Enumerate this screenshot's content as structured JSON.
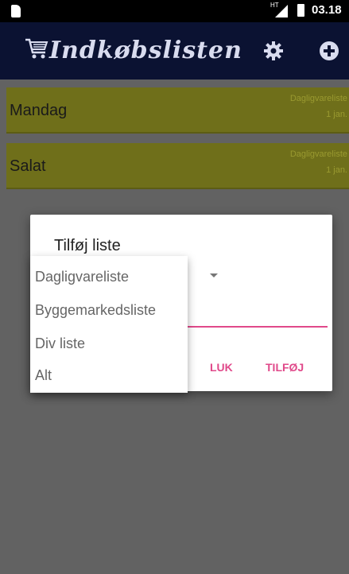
{
  "status_bar": {
    "time": "03.18",
    "network": "HT"
  },
  "app_bar": {
    "title": "Indkøbslisten",
    "icons": {
      "cart": "shopping-cart-icon",
      "settings": "gear-icon",
      "add": "plus-circle-icon"
    }
  },
  "lists": [
    {
      "name": "Mandag",
      "type": "Dagligvareliste",
      "date": "1 jan."
    },
    {
      "name": "Salat",
      "type": "Dagligvareliste",
      "date": "1 jan."
    }
  ],
  "dialog": {
    "title": "Tilføj liste",
    "buttons": {
      "close": "LUK",
      "add": "TILFØJ"
    }
  },
  "dropdown": {
    "options": [
      "Dagligvareliste",
      "Byggemarkedsliste",
      "Div liste",
      "Alt"
    ]
  },
  "colors": {
    "app_bar": "#0b1232",
    "row": "#6f6f1a",
    "accent": "#e0498a"
  }
}
